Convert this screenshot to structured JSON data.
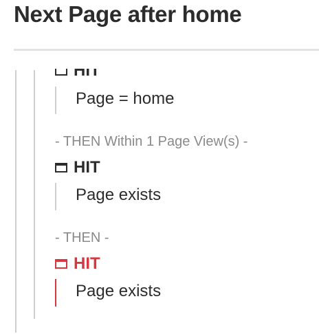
{
  "header": {
    "title": "Next Page after home"
  },
  "sequence": {
    "checkpoints": [
      {
        "label": "HIT",
        "icon": "hit-container-icon",
        "condition": "Page = home",
        "color": "#2c2c2c",
        "partially_hidden": true
      },
      {
        "label": "HIT",
        "icon": "hit-container-icon",
        "condition": "Page exists",
        "color": "#2c2c2c"
      },
      {
        "label": "HIT",
        "icon": "hit-container-icon",
        "condition": "Page exists",
        "color": "#d7373f"
      }
    ],
    "then_1": "- THEN Within 1 Page View(s) -",
    "then_2": "- THEN -"
  }
}
